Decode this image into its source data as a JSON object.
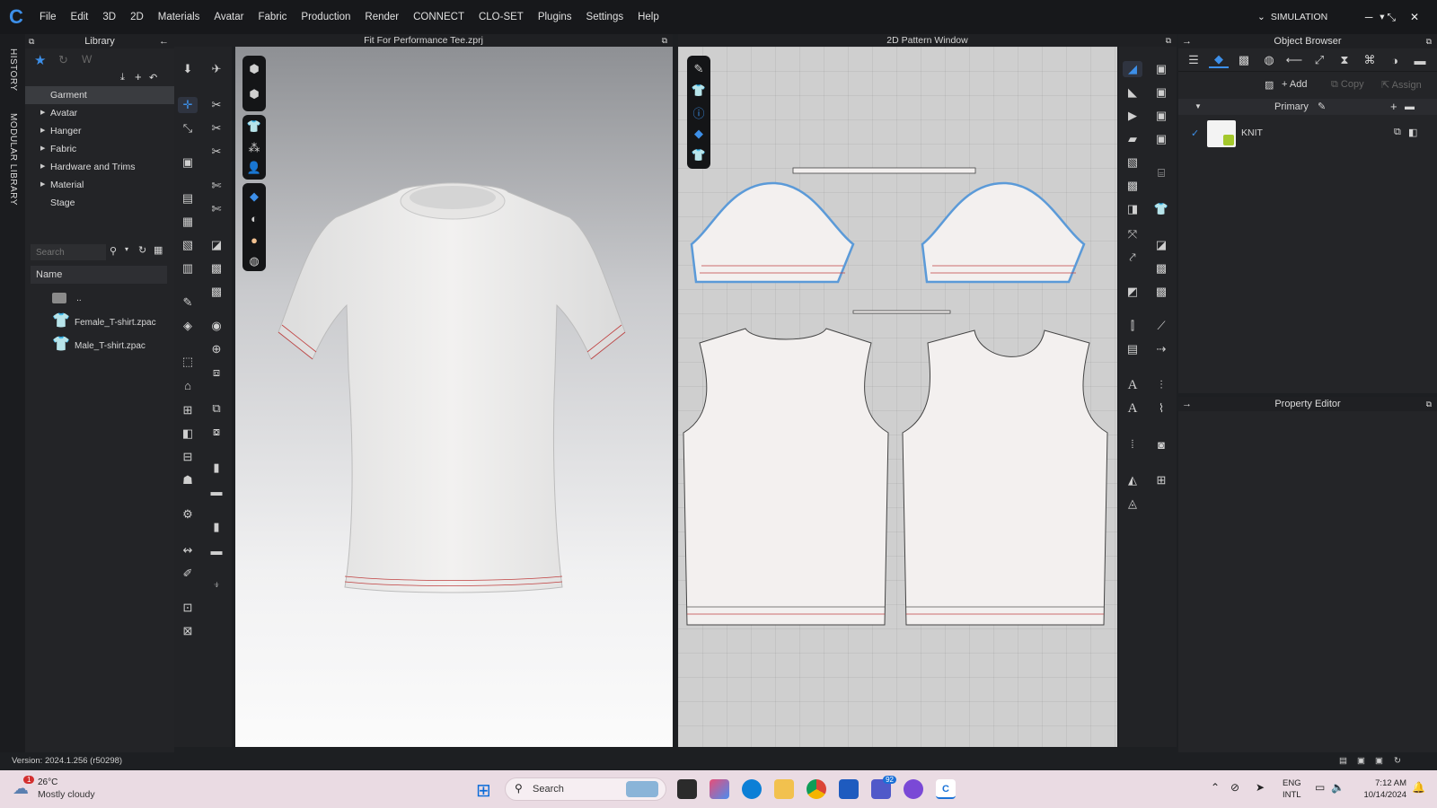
{
  "menubar": {
    "items": [
      "File",
      "Edit",
      "3D",
      "2D",
      "Materials",
      "Avatar",
      "Fabric",
      "Production",
      "Render",
      "CONNECT",
      "CLO-SET",
      "Plugins",
      "Settings",
      "Help"
    ],
    "mode": "SIMULATION"
  },
  "sidetabs": {
    "history": "HISTORY",
    "modular": "MODULAR LIBRARY"
  },
  "library": {
    "title": "Library",
    "tree": [
      "Garment",
      "Avatar",
      "Hanger",
      "Fabric",
      "Hardware and Trims",
      "Material",
      "Stage"
    ],
    "search_placeholder": "Search",
    "column_name": "Name",
    "files": [
      "..",
      "Female_T-shirt.zpac",
      "Male_T-shirt.zpac"
    ]
  },
  "view3d": {
    "title": "Fit For Performance Tee.zprj"
  },
  "view2d": {
    "title": "2D Pattern Window"
  },
  "objbrowser": {
    "title": "Object Browser",
    "add": "Add",
    "copy": "Copy",
    "assign": "Assign",
    "group": "Primary",
    "fabric": "KNIT"
  },
  "propeditor": {
    "title": "Property Editor"
  },
  "status": {
    "version": "Version: 2024.1.256 (r50298)"
  },
  "taskbar": {
    "weather_temp": "26°C",
    "weather_desc": "Mostly cloudy",
    "weather_badge": "1",
    "search": "Search",
    "lang1": "ENG",
    "lang2": "INTL",
    "time": "7:12 AM",
    "date": "10/14/2024",
    "teams_badge": "92"
  }
}
